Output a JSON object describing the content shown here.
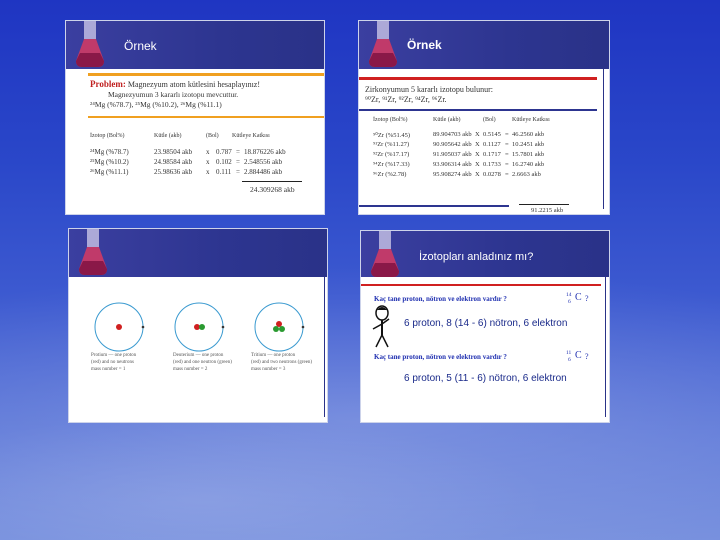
{
  "slide1": {
    "title": "Örnek",
    "problem_label": "Problem:",
    "problem_text": "Magnezyum atom kütlesini hesaplayınız!",
    "problem_line2": "Magnezyumun 3 kararlı izotopu mevcuttur.",
    "problem_line3": "²⁴Mg (%78.7), ²⁵Mg (%10.2), ²⁶Mg (%11.1)",
    "headers": [
      "İzotop (Bol%)",
      "Kütle (akb)",
      "(Bol)",
      "Kütleye Katkısı"
    ],
    "rows": [
      {
        "iso": "²⁴Mg   (%78.7)",
        "mass": "23.98504 akb",
        "op": "x",
        "ab": "0.787",
        "eq": "=",
        "contrib": "18.876226 akb"
      },
      {
        "iso": "²⁵Mg   (%10.2)",
        "mass": "24.98584 akb",
        "op": "x",
        "ab": "0.102",
        "eq": "=",
        "contrib": "2.548556 akb"
      },
      {
        "iso": "²⁶Mg   (%11.1)",
        "mass": "25.98636 akb",
        "op": "x",
        "ab": "0.111",
        "eq": "=",
        "contrib": "2.884486 akb"
      }
    ],
    "total": "24.309268 akb"
  },
  "slide2": {
    "title": "Örnek",
    "intro": "Zirkonyumun 5 kararlı izotopu bulunur:",
    "isotopes": "⁹⁰Zr, ⁹¹Zr, ⁹²Zr, ⁹⁴Zr, ⁹⁶Zr.",
    "headers": [
      "İzotop (Bol%)",
      "Kütle (akb)",
      "(Bol)",
      "Kütleye Katkısı"
    ],
    "rows": [
      {
        "iso": "⁹⁰Zr  (%51.45)",
        "mass": "89.904703 akb",
        "op": "X",
        "ab": "0.5145",
        "eq": "=",
        "contrib": "46.2560 akb"
      },
      {
        "iso": "⁹¹Zr  (%11.27)",
        "mass": "90.905642 akb",
        "op": "X",
        "ab": "0.1127",
        "eq": "=",
        "contrib": "10.2451 akb"
      },
      {
        "iso": "⁹²Zr  (%17.17)",
        "mass": "91.905037 akb",
        "op": "X",
        "ab": "0.1717",
        "eq": "=",
        "contrib": "15.7801 akb"
      },
      {
        "iso": "⁹⁴Zr  (%17.33)",
        "mass": "93.906314 akb",
        "op": "X",
        "ab": "0.1733",
        "eq": "=",
        "contrib": "16.2740 akb"
      },
      {
        "iso": "⁹⁶Zr  (%2.78)",
        "mass": "95.908274 akb",
        "op": "X",
        "ab": "0.0278",
        "eq": "=",
        "contrib": "2.6663 akb"
      }
    ],
    "total": "91.2215 akb"
  },
  "slide3": {
    "atoms": [
      {
        "caption1": "Protium — one proton",
        "caption2": "(red) and no neutrons",
        "caption3": "mass number = 1"
      },
      {
        "caption1": "Deuterium — one proton",
        "caption2": "(red) and one neutron (green)",
        "caption3": "mass number = 2"
      },
      {
        "caption1": "Tritium — one proton",
        "caption2": "(red) and two neutrons (green)",
        "caption3": "mass number = 3"
      }
    ]
  },
  "slide4": {
    "title": "İzotopları anladınız mı?",
    "q1": "Kaç tane proton, nötron ve elektron vardır ?",
    "q1_mass": "14",
    "q1_atomic": "6",
    "q1_symbol": "C",
    "q1_tail": "?",
    "a1": "6 proton, 8 (14 - 6) nötron, 6 elektron",
    "q2": "Kaç tane proton, nötron ve elektron vardır ?",
    "q2_mass": "11",
    "q2_atomic": "6",
    "q2_symbol": "C",
    "q2_tail": "?",
    "a2": "6 proton, 5 (11 - 6) nötron, 6 elektron"
  },
  "colors": {
    "header": "#2d3590",
    "accent_orange": "#f0a020",
    "accent_red": "#d02020",
    "answer_blue": "#1a2a8a",
    "question_blue": "#1f2fb0"
  }
}
